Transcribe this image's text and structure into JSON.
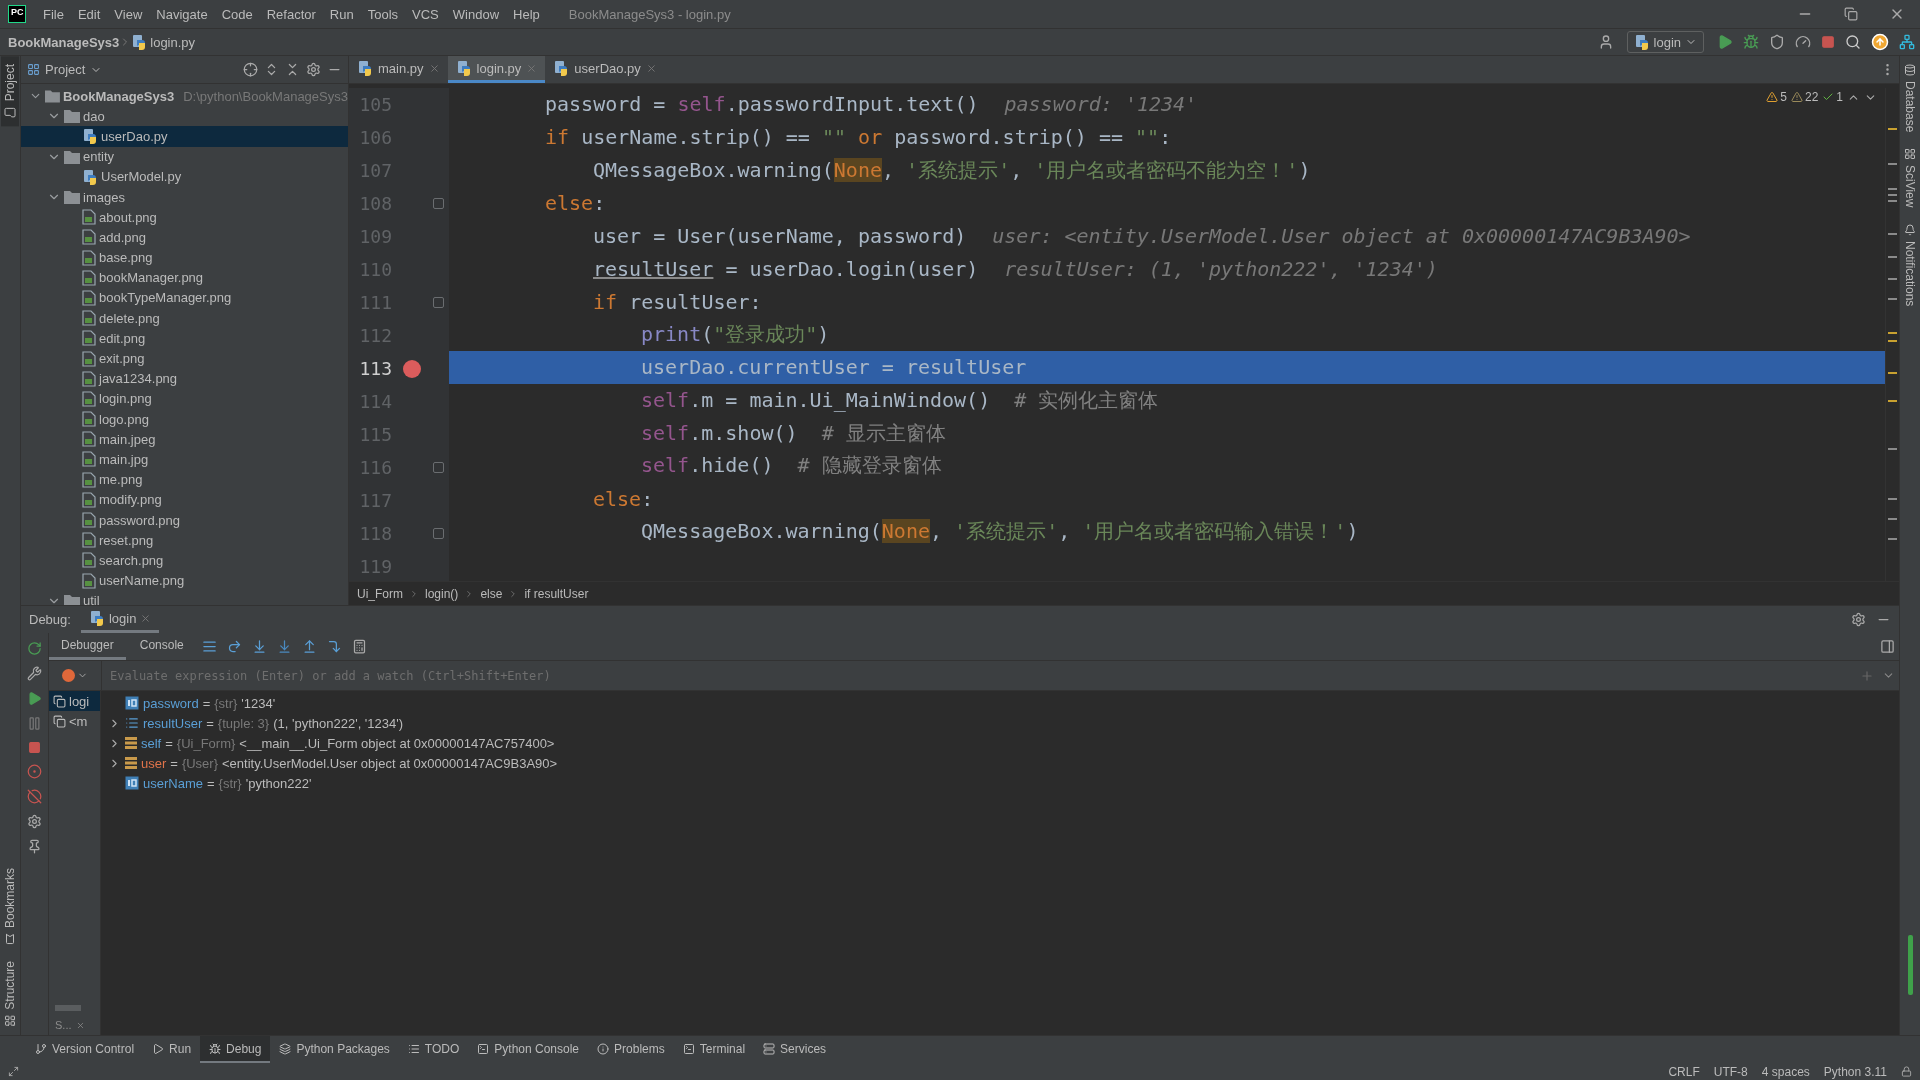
{
  "app": {
    "logo": "PC",
    "menu": [
      "File",
      "Edit",
      "View",
      "Navigate",
      "Code",
      "Refactor",
      "Run",
      "Tools",
      "VCS",
      "Window",
      "Help"
    ],
    "title": "BookManageSys3 - login.py"
  },
  "navbar": {
    "project": "BookManageSys3",
    "file": "login.py",
    "run_config": "login"
  },
  "left_strip": {
    "top": [
      "Project"
    ],
    "bottom": [
      "Bookmarks",
      "Structure"
    ]
  },
  "right_strip": [
    "Database",
    "SciView",
    "Notifications"
  ],
  "project": {
    "title": "Project",
    "tree": [
      {
        "label": "BookManageSys3",
        "path": "D:\\python\\BookManageSys3",
        "kind": "folder",
        "expanded": true,
        "selected": false,
        "children": [
          {
            "label": "dao",
            "kind": "folder",
            "expanded": true,
            "selected": false,
            "children": [
              {
                "label": "userDao.py",
                "kind": "python",
                "selected": true
              }
            ]
          },
          {
            "label": "entity",
            "kind": "folder",
            "expanded": true,
            "selected": false,
            "children": [
              {
                "label": "UserModel.py",
                "kind": "python",
                "selected": false
              }
            ]
          },
          {
            "label": "images",
            "kind": "folder",
            "expanded": true,
            "selected": false,
            "children": [
              {
                "label": "about.png",
                "kind": "image",
                "selected": false
              },
              {
                "label": "add.png",
                "kind": "image",
                "selected": false
              },
              {
                "label": "base.png",
                "kind": "image",
                "selected": false
              },
              {
                "label": "bookManager.png",
                "kind": "image",
                "selected": false
              },
              {
                "label": "bookTypeManager.png",
                "kind": "image",
                "selected": false
              },
              {
                "label": "delete.png",
                "kind": "image",
                "selected": false
              },
              {
                "label": "edit.png",
                "kind": "image",
                "selected": false
              },
              {
                "label": "exit.png",
                "kind": "image",
                "selected": false
              },
              {
                "label": "java1234.png",
                "kind": "image",
                "selected": false
              },
              {
                "label": "login.png",
                "kind": "image",
                "selected": false
              },
              {
                "label": "logo.png",
                "kind": "image",
                "selected": false
              },
              {
                "label": "main.jpeg",
                "kind": "image",
                "selected": false
              },
              {
                "label": "main.jpg",
                "kind": "image",
                "selected": false
              },
              {
                "label": "me.png",
                "kind": "image",
                "selected": false
              },
              {
                "label": "modify.png",
                "kind": "image",
                "selected": false
              },
              {
                "label": "password.png",
                "kind": "image",
                "selected": false
              },
              {
                "label": "reset.png",
                "kind": "image",
                "selected": false
              },
              {
                "label": "search.png",
                "kind": "image",
                "selected": false
              },
              {
                "label": "userName.png",
                "kind": "image",
                "selected": false
              }
            ]
          },
          {
            "label": "util",
            "kind": "folder",
            "expanded": true,
            "selected": false
          }
        ]
      }
    ]
  },
  "editor": {
    "tabs": [
      {
        "label": "main.py",
        "selected": false
      },
      {
        "label": "login.py",
        "selected": true
      },
      {
        "label": "userDao.py",
        "selected": false
      }
    ],
    "inspections": {
      "warnings": "5",
      "weak_warnings": "22",
      "passed": "1"
    },
    "lines": [
      {
        "number": "105",
        "tokens": [
          {
            "kind": "plain",
            "text": "password = "
          },
          {
            "kind": "self",
            "text": "self"
          },
          {
            "kind": "plain",
            "text": ".passwordInput.text()"
          }
        ],
        "hint": "password: '1234'"
      },
      {
        "number": "106",
        "tokens": [
          {
            "kind": "keyword",
            "text": "if"
          },
          {
            "kind": "plain",
            "text": " userName.strip() == "
          },
          {
            "kind": "string",
            "text": "\"\" "
          },
          {
            "kind": "keyword",
            "text": "or"
          },
          {
            "kind": "plain",
            "text": " password.strip() == "
          },
          {
            "kind": "string",
            "text": "\"\""
          },
          {
            "kind": "plain",
            "text": ":"
          }
        ],
        "children": [
          {
            "number": "107",
            "tokens": [
              {
                "kind": "plain",
                "text": "QMessageBox.warning("
              },
              {
                "kind": "none",
                "text": "None"
              },
              {
                "kind": "plain",
                "text": ", "
              },
              {
                "kind": "string",
                "text": "'系统提示'"
              },
              {
                "kind": "plain",
                "text": ", "
              },
              {
                "kind": "string",
                "text": "'用户名或者密码不能为空！'"
              },
              {
                "kind": "plain",
                "text": ")"
              }
            ]
          }
        ]
      },
      {
        "number": "108",
        "fold": true,
        "tokens": [
          {
            "kind": "keyword",
            "text": "else"
          },
          {
            "kind": "plain",
            "text": ":"
          }
        ],
        "children": [
          {
            "number": "109",
            "tokens": [
              {
                "kind": "plain",
                "text": "user = User(userName, password)"
              }
            ],
            "hint": "user: <entity.UserModel.User object at 0x00000147AC9B3A90>"
          },
          {
            "number": "110",
            "tokens": [
              {
                "kind": "underlined",
                "text": "resultUser"
              },
              {
                "kind": "plain",
                "text": " = userDao.login(user)"
              }
            ],
            "hint": "resultUser: (1, 'python222', '1234')"
          },
          {
            "number": "111",
            "fold": true,
            "tokens": [
              {
                "kind": "keyword",
                "text": "if"
              },
              {
                "kind": "plain",
                "text": " resultUser:"
              }
            ],
            "children": [
              {
                "number": "112",
                "tokens": [
                  {
                    "kind": "builtin",
                    "text": "print"
                  },
                  {
                    "kind": "plain",
                    "text": "("
                  },
                  {
                    "kind": "string",
                    "text": "\"登录成功\""
                  },
                  {
                    "kind": "plain",
                    "text": ")"
                  }
                ]
              },
              {
                "number": "113",
                "breakpoint": true,
                "current": true,
                "tokens": [
                  {
                    "kind": "plain",
                    "text": "userDao.currentUser = resultUser"
                  }
                ]
              },
              {
                "number": "114",
                "tokens": [
                  {
                    "kind": "self",
                    "text": "self"
                  },
                  {
                    "kind": "plain",
                    "text": ".m = main.Ui_MainWindow()  "
                  },
                  {
                    "kind": "comment",
                    "text": "# 实例化主窗体"
                  }
                ]
              },
              {
                "number": "115",
                "tokens": [
                  {
                    "kind": "self",
                    "text": "self"
                  },
                  {
                    "kind": "plain",
                    "text": ".m.show()  "
                  },
                  {
                    "kind": "comment",
                    "text": "# 显示主窗体"
                  }
                ]
              },
              {
                "number": "116",
                "fold": true,
                "tokens": [
                  {
                    "kind": "self",
                    "text": "self"
                  },
                  {
                    "kind": "plain",
                    "text": ".hide()  "
                  },
                  {
                    "kind": "comment",
                    "text": "# 隐藏登录窗体"
                  }
                ]
              }
            ]
          },
          {
            "number": "117",
            "tokens": [
              {
                "kind": "keyword",
                "text": "else"
              },
              {
                "kind": "plain",
                "text": ":"
              }
            ],
            "children": [
              {
                "number": "118",
                "fold": true,
                "tokens": [
                  {
                    "kind": "plain",
                    "text": "QMessageBox.warning("
                  },
                  {
                    "kind": "none",
                    "text": "None"
                  },
                  {
                    "kind": "plain",
                    "text": ", "
                  },
                  {
                    "kind": "string",
                    "text": "'系统提示'"
                  },
                  {
                    "kind": "plain",
                    "text": ", "
                  },
                  {
                    "kind": "string",
                    "text": "'用户名或者密码输入错误！'"
                  },
                  {
                    "kind": "plain",
                    "text": ")"
                  }
                ]
              }
            ]
          }
        ]
      },
      {
        "number": "119"
      }
    ],
    "breadcrumb": [
      "Ui_Form",
      "login()",
      "else",
      "if resultUser"
    ]
  },
  "debug": {
    "label": "Debug:",
    "session": "login",
    "tabs": [
      {
        "label": "Debugger",
        "selected": true
      },
      {
        "label": "Console",
        "selected": false
      }
    ],
    "eval_placeholder": "Evaluate expression (Enter) or add a watch (Ctrl+Shift+Enter)",
    "frames": [
      {
        "label": "logi",
        "selected": true
      },
      {
        "label": "<m",
        "selected": false
      }
    ],
    "frames_tab": "S...",
    "variables": [
      {
        "kind": "primitive",
        "name": "password",
        "equals": "=",
        "type": "{str}",
        "value": "'1234'",
        "expandable": false,
        "changed": false
      },
      {
        "kind": "list",
        "name": "resultUser",
        "equals": "=",
        "type": "{tuple: 3}",
        "value": "(1, 'python222', '1234')",
        "expandable": true,
        "changed": false
      },
      {
        "kind": "object",
        "name": "self",
        "equals": "=",
        "type": "{Ui_Form}",
        "value": "<__main__.Ui_Form object at 0x00000147AC757400>",
        "expandable": true,
        "changed": false
      },
      {
        "kind": "object",
        "name": "user",
        "equals": "=",
        "type": "{User}",
        "value": "<entity.UserModel.User object at 0x00000147AC9B3A90>",
        "expandable": true,
        "changed": true
      },
      {
        "kind": "primitive",
        "name": "userName",
        "equals": "=",
        "type": "{str}",
        "value": "'python222'",
        "expandable": false,
        "changed": false
      }
    ]
  },
  "tool_windows": [
    {
      "label": "Version Control",
      "selected": false
    },
    {
      "label": "Run",
      "selected": false
    },
    {
      "label": "Debug",
      "selected": true
    },
    {
      "label": "Python Packages",
      "selected": false
    },
    {
      "label": "TODO",
      "selected": false
    },
    {
      "label": "Python Console",
      "selected": false
    },
    {
      "label": "Problems",
      "selected": false
    },
    {
      "label": "Terminal",
      "selected": false
    },
    {
      "label": "Services",
      "selected": false
    }
  ],
  "status": [
    "CRLF",
    "UTF-8",
    "4 spaces",
    "Python 3.11"
  ]
}
